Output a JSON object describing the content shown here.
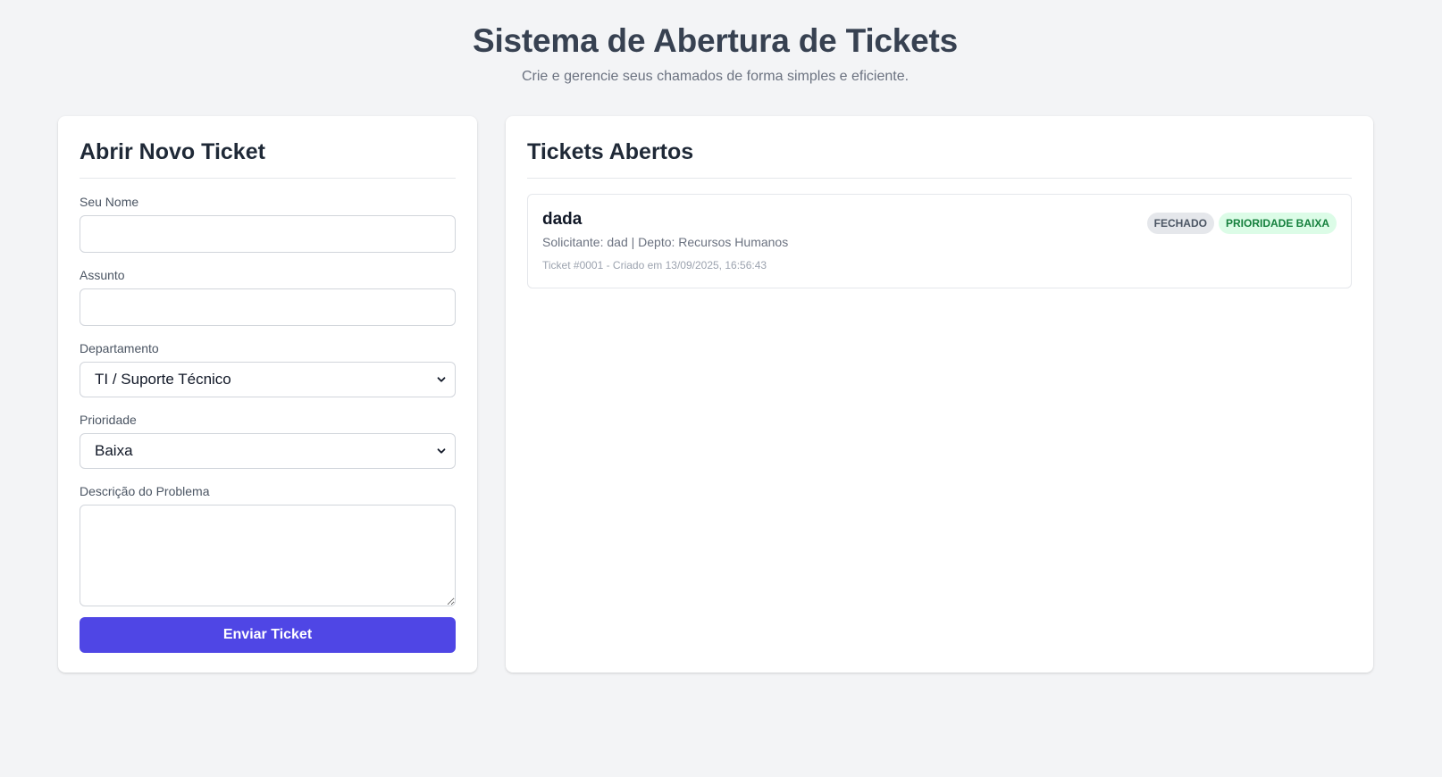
{
  "header": {
    "title": "Sistema de Abertura de Tickets",
    "subtitle": "Crie e gerencie seus chamados de forma simples e eficiente."
  },
  "form": {
    "title": "Abrir Novo Ticket",
    "name": {
      "label": "Seu Nome",
      "value": "",
      "placeholder": ""
    },
    "subject": {
      "label": "Assunto",
      "value": "",
      "placeholder": ""
    },
    "department": {
      "label": "Departamento",
      "selected": "TI / Suporte Técnico"
    },
    "priority": {
      "label": "Prioridade",
      "selected": "Baixa"
    },
    "description": {
      "label": "Descrição do Problema",
      "value": "",
      "placeholder": ""
    },
    "submit_label": "Enviar Ticket"
  },
  "ticket_list": {
    "title": "Tickets Abertos",
    "tickets": [
      {
        "subject": "dada",
        "meta": "Solicitante: dad | Depto: Recursos Humanos",
        "footer": "Ticket #0001 - Criado em 13/09/2025, 16:56:43",
        "status": "FECHADO",
        "priority": "PRIORIDADE BAIXA"
      }
    ]
  },
  "colors": {
    "background": "#f3f4f6",
    "primary_button": "#4f46e5",
    "status_badge_bg": "#e5e7eb",
    "priority_low_bg": "#dcfce7",
    "priority_low_text": "#15803d"
  },
  "icons": {
    "select_arrow": "chevron-down-icon"
  }
}
